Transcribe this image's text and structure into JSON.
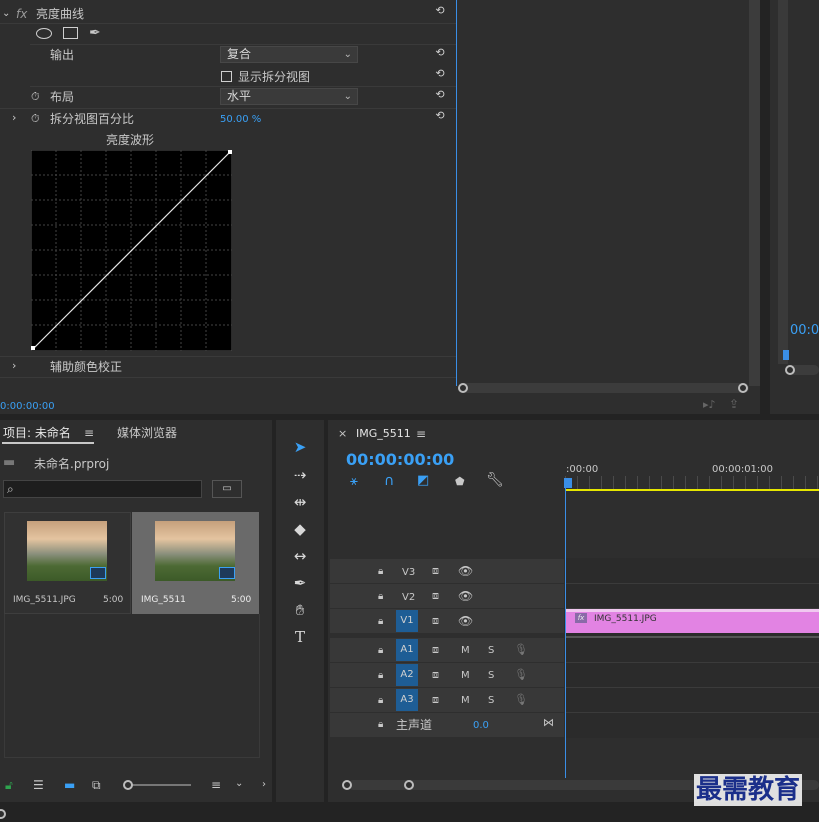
{
  "effect_controls": {
    "effect_name": "亮度曲线",
    "fx_label": "fx",
    "output_label": "输出",
    "output_value": "复合",
    "split_view_label": "显示拆分视图",
    "layout_label": "布局",
    "layout_value": "水平",
    "split_percent_label": "拆分视图百分比",
    "split_percent_value": "50.00 %",
    "waveform_title": "亮度波形",
    "secondary_label": "辅助颜色校正",
    "timecode": "0:00:00:00"
  },
  "program_monitor": {
    "timecode": "00:0"
  },
  "project_panel": {
    "tab_project": "项目: 未命名",
    "tab_media_browser": "媒体浏览器",
    "project_file": "未命名.prproj",
    "search_placeholder": "",
    "items": [
      {
        "name": "IMG_5511.JPG",
        "duration": "5:00"
      },
      {
        "name": "IMG_5511",
        "duration": "5:00"
      }
    ]
  },
  "timeline": {
    "tab_name": "IMG_5511",
    "timecode": "00:00:00:00",
    "ruler_start": ":00:00",
    "ruler_mid": "00:00:01:00",
    "tracks_video": [
      "V3",
      "V2",
      "V1"
    ],
    "tracks_audio": [
      "A1",
      "A2",
      "A3"
    ],
    "mute_label": "M",
    "solo_label": "S",
    "master_label": "主声道",
    "master_value": "0.0",
    "clip_name": "IMG_5511.JPG",
    "clip_fx": "fx"
  },
  "watermark": "最需教育",
  "colors": {
    "accent_blue": "#3aa0f5",
    "clip_pink": "#e283e3",
    "playhead": "#3a8ee6",
    "work_area": "#e6e600",
    "track_target": "#1e5d95"
  }
}
